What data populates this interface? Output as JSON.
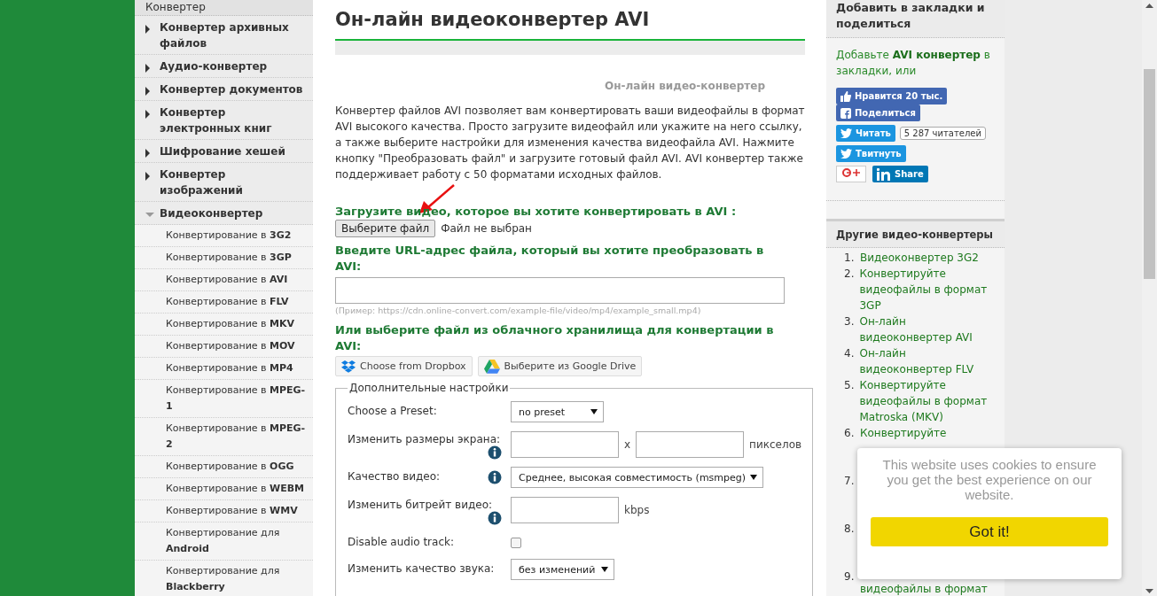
{
  "sidebar": {
    "header": "Конвертер",
    "items": [
      {
        "label": "Конвертер архивных файлов",
        "expanded": false
      },
      {
        "label": "Аудио-конвертер",
        "expanded": false
      },
      {
        "label": "Конвертер документов",
        "expanded": false
      },
      {
        "label": "Конвертер электронных книг",
        "expanded": false
      },
      {
        "label": "Шифрование хешей",
        "expanded": false
      },
      {
        "label": "Конвертер изображений",
        "expanded": false
      },
      {
        "label": "Видеоконвертер",
        "expanded": true,
        "children": [
          "Конвертирование в **3G2**",
          "Конвертирование в **3GP**",
          "Конвертирование в **AVI**",
          "Конвертирование в **FLV**",
          "Конвертирование в **MKV**",
          "Конвертирование в **MOV**",
          "Конвертирование в **MP4**",
          "Конвертирование в **MPEG-1**",
          "Конвертирование в **MPEG-2**",
          "Конвертирование в **OGG**",
          "Конвертирование в **WEBM**",
          "Конвертирование в **WMV**",
          "Конвертирование для **Android**",
          "Конвертирование для **Blackberry**"
        ]
      }
    ]
  },
  "main": {
    "title": "Он-лайн видеоконвертер AVI",
    "tagline": "Он-лайн видео-конвертер",
    "description": "Конвертер файлов AVI позволяет вам конвертировать ваши видеофайлы в формат AVI высокого качества. Просто загрузите видеофайл или укажите на него ссылку, а также выберите настройки для изменения качества видеофайла AVI. Нажмите кнопку \"Преобразовать файл\" и загрузите готовый файл AVI. AVI конвертер также поддерживает работу с 50 форматами исходных файлов.",
    "upload": {
      "heading": "Загрузите видео, которое вы хотите конвертировать в AVI :",
      "button": "Выберите файл",
      "status": "Файл не выбран"
    },
    "url": {
      "heading": "Введите URL-адрес файла, который вы хотите преобразовать в AVI:",
      "hint": "(Пример: https://cdn.online-convert.com/example-file/video/mp4/example_small.mp4)"
    },
    "cloud": {
      "heading": "Или выберите файл из облачного хранилища для конвертации в AVI:",
      "buttons": [
        {
          "label": "Choose from Dropbox",
          "kind": "dropbox"
        },
        {
          "label": "Выберите из Google Drive",
          "kind": "drive"
        }
      ]
    },
    "settings": {
      "legend": "Дополнительные настройки",
      "rows": [
        {
          "kind": "select",
          "label": "Choose a Preset:",
          "info": false,
          "value": "no preset"
        },
        {
          "kind": "size",
          "label": "Изменить размеры экрана:",
          "info": true,
          "separator": "x",
          "unit": "пикселов"
        },
        {
          "kind": "wideselect",
          "label": "Качество видео:",
          "info": true,
          "value": "Среднее, высокая совместимость (msmpeg)"
        },
        {
          "kind": "number",
          "label": "Изменить битрейт видео:",
          "info": true,
          "unit": "kbps"
        },
        {
          "kind": "checkbox",
          "label": "Disable audio track:",
          "info": false,
          "checked": false
        },
        {
          "kind": "select",
          "label": "Изменить качество звука:",
          "info": false,
          "value": "без изменений"
        }
      ]
    }
  },
  "share": {
    "header": "Добавить в закладки и поделиться",
    "text": "Добавьте **AVI конвертер** в закладки, или",
    "like": "Нравится 20 тыс.",
    "share": "Поделиться",
    "follow": "Читать",
    "followers": "5 287 читателей",
    "tweet": "Твитнуть",
    "linkedin": "Share"
  },
  "related": {
    "header": "Другие видео-конвертеры",
    "items": [
      {
        "number": "1.",
        "text": "Видеоконвертер 3G2"
      },
      {
        "number": "2.",
        "text": "Конвертируйте видеофайлы в формат 3GP"
      },
      {
        "number": "3.",
        "text": "Он-лайн видеоконвертер AVI"
      },
      {
        "number": "4.",
        "text": "Он-лайн видеоконвертер FLV"
      },
      {
        "number": "5.",
        "text": "Конвертируйте видеофайлы в формат Matroska (MKV)"
      },
      {
        "number": "6.",
        "text": "Конвертируйте"
      },
      {
        "number": "7."
      },
      {
        "number": "8."
      },
      {
        "number": "9.",
        "text": "видеофайлы в формат"
      }
    ]
  },
  "cookie": {
    "message": "This website uses cookies to ensure you get the best experience on our website.",
    "button": "Got it!"
  }
}
